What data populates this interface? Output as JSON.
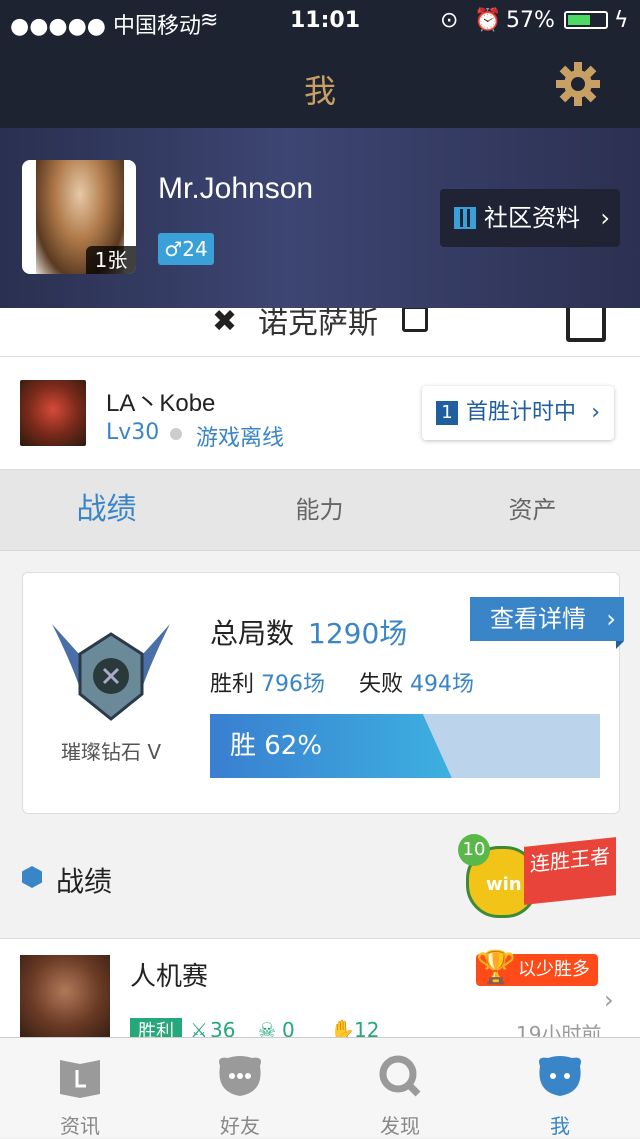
{
  "status_bar": {
    "carrier": "●●●●● 中国移动",
    "time": "11:01",
    "battery": "57%"
  },
  "nav": {
    "title": "我"
  },
  "profile": {
    "username": "Mr.Johnson",
    "photo_count": "1张",
    "gender_age": "♂24",
    "community_label": "社区资料"
  },
  "server": {
    "name": "诺克萨斯"
  },
  "summoner": {
    "name": "LA丶Kobe",
    "level": "Lv30",
    "status": "游戏离线",
    "first_win": "首胜计时中",
    "first_win_num": "1"
  },
  "tabs": [
    "战绩",
    "能力",
    "资产"
  ],
  "stats": {
    "rank": "璀璨钻石 V",
    "total_label": "总局数",
    "total_value": "1290场",
    "detail_button": "查看详情",
    "wins_label": "胜利",
    "wins_value": "796场",
    "losses_label": "失败",
    "losses_value": "494场",
    "win_rate_text": "胜 62%",
    "win_rate": 0.62
  },
  "section": {
    "title": "战绩",
    "streak_count": "10",
    "streak_word": "win",
    "streak_label": "连胜王者"
  },
  "match": {
    "mode": "人机赛",
    "tag": "以少胜多",
    "result": "胜利",
    "kills": "36",
    "deaths": "0",
    "assists": "12",
    "time": "19小时前"
  },
  "tabbar": [
    "资讯",
    "好友",
    "发现",
    "我"
  ],
  "colors": {
    "accent": "#3a85c8",
    "win": "#26a87a",
    "nav_bg": "#1e2332",
    "gold": "#c9a063"
  }
}
